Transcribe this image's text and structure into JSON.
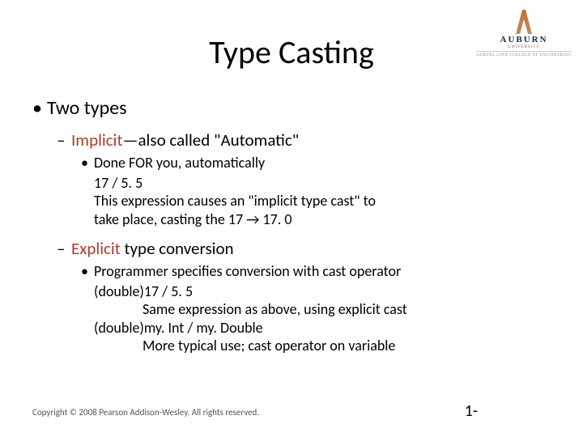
{
  "logo": {
    "name": "AUBURN",
    "university": "UNIVERSITY",
    "college": "SAMUEL GINN COLLEGE OF ENGINEERING"
  },
  "title": "Type Casting",
  "bullet_l1": "Two types",
  "implicit": {
    "term": "Implicit",
    "rest": "—also called \"Automatic\"",
    "sub_lead": "Done FOR you, automatically",
    "line2": "17 / 5. 5",
    "line3": "This expression causes an \"implicit type cast\" to",
    "line4": "take place, casting the 17 → 17. 0"
  },
  "explicit": {
    "term": "Explicit",
    "rest": " type conversion",
    "sub_lead": "Programmer specifies conversion with cast operator",
    "line2": "(double)17 / 5. 5",
    "line3": "Same expression as above, using explicit cast",
    "line4": "(double)my. Int / my. Double",
    "line5": "More typical use; cast operator on variable"
  },
  "copyright": "Copyright © 2008 Pearson Addison-Wesley. All rights reserved.",
  "pagenum": "1-"
}
